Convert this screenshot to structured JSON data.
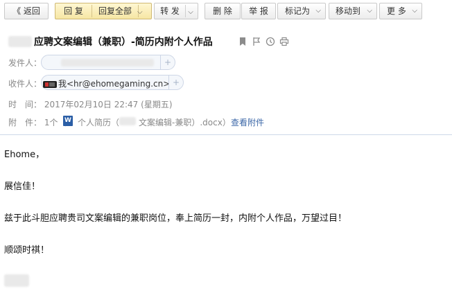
{
  "toolbar": {
    "back_label": "《 返回",
    "reply_label": "回 复",
    "reply_all_label": "回复全部",
    "forward_label": "转 发",
    "delete_label": "删 除",
    "report_label": "举 报",
    "mark_label": "标记为",
    "move_label": "移动到",
    "more_label": "更 多"
  },
  "mail": {
    "subject": "应聘文案编辑（兼职）-简历内附个人作品",
    "from_label": "发件人：",
    "to_label": "收件人：",
    "to_value": "我<hr@ehomegaming.cn>",
    "time_label": "时　间：",
    "time_value": "2017年02月10日 22:47 (星期五)",
    "attach_label": "附　件：",
    "attach_count": "1个（",
    "attach_name_prefix": "个人简历（",
    "attach_name_suffix": "文案编辑-兼职）.docx）",
    "view_attach": "查看附件"
  },
  "body": {
    "line1": "Ehome，",
    "line2": "展信佳！",
    "line3": "兹于此斗胆应聘贵司文案编辑的兼职岗位，奉上简历一封，内附个人作品，万望过目！",
    "line4": "顺颂时祺！"
  },
  "icons": [
    "bookmark-icon",
    "flag-icon",
    "clock-icon",
    "print-icon",
    "word-doc-icon",
    "avatar-icon",
    "add-icon",
    "chevron-down-icon"
  ],
  "colors": {
    "accent_link": "#3d68a8",
    "highlight_button": "#f6e6a4"
  }
}
